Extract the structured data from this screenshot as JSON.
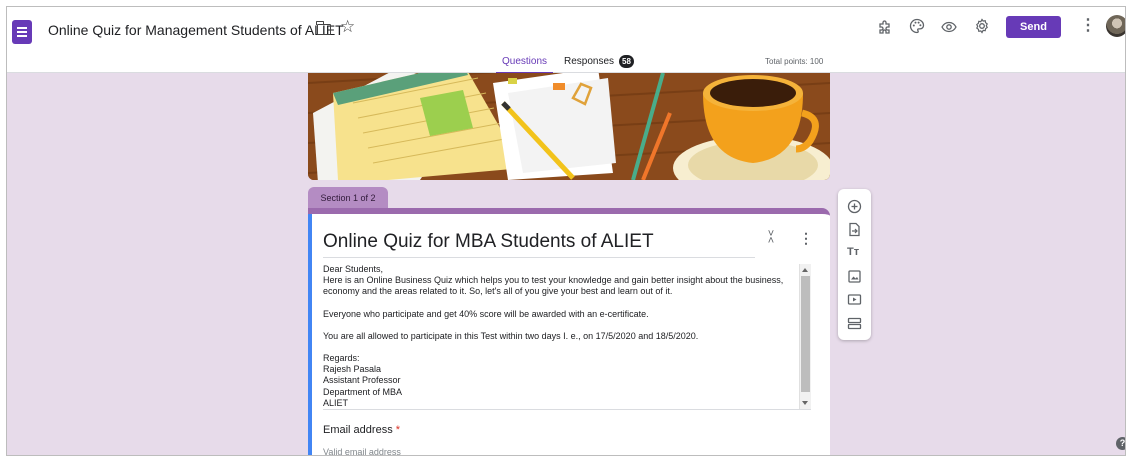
{
  "header": {
    "doc_title": "Online Quiz for Management Students of ALIET",
    "send_label": "Send",
    "icons": [
      "addon-puzzle-icon",
      "palette-icon",
      "preview-eye-icon",
      "settings-gear-icon",
      "more-vert-icon"
    ]
  },
  "tabs": {
    "questions": "Questions",
    "responses": "Responses",
    "responses_count": "58",
    "total_points": "Total points: 100"
  },
  "section": {
    "label": "Section 1 of 2",
    "title": "Online Quiz for MBA Students of ALIET",
    "description": {
      "greeting": "Dear Students,",
      "intro": "Here is an Online Business Quiz which helps you to test your knowledge and gain better insight about the business, economy and the areas related to it. So, let's all of you give your best and learn out of it.",
      "certificate": "Everyone who participate and get 40% score will be awarded with an e-certificate.",
      "dates": "You are all allowed to participate in this Test within two days I. e., on 17/5/2020 and 18/5/2020.",
      "regards": "Regards:",
      "name": "Rajesh Pasala",
      "designation": "Assistant Professor",
      "department": "Department of MBA",
      "institute": "ALIET"
    }
  },
  "email_field": {
    "label": "Email address",
    "required_mark": "*",
    "placeholder": "Valid email address"
  },
  "toolbar": {
    "items": [
      "add-question-icon",
      "import-questions-icon",
      "add-title-icon",
      "add-image-icon",
      "add-video-icon",
      "add-section-icon"
    ],
    "title_glyph": "Tт"
  },
  "colors": {
    "accent": "#673ab7",
    "background": "#e7dbea",
    "section_tab": "#b48cc3",
    "section_bar": "#9b6aad",
    "focus_bar": "#4285f4"
  }
}
